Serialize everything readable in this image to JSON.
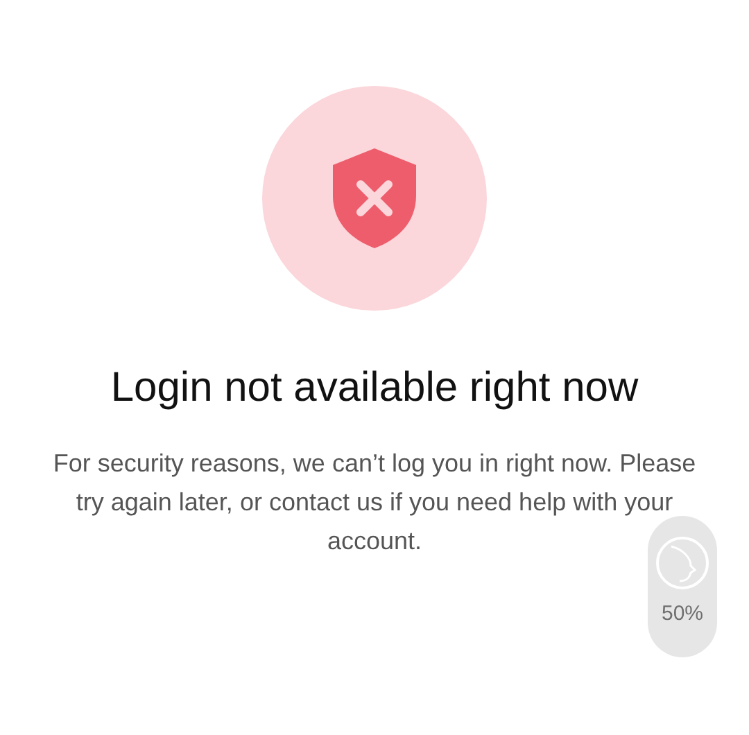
{
  "title": "Login not available right now",
  "message": "For security reasons, we can’t log you in right now. Please try again later, or contact us if you need help with your account.",
  "overlay": {
    "reading": "50%"
  }
}
